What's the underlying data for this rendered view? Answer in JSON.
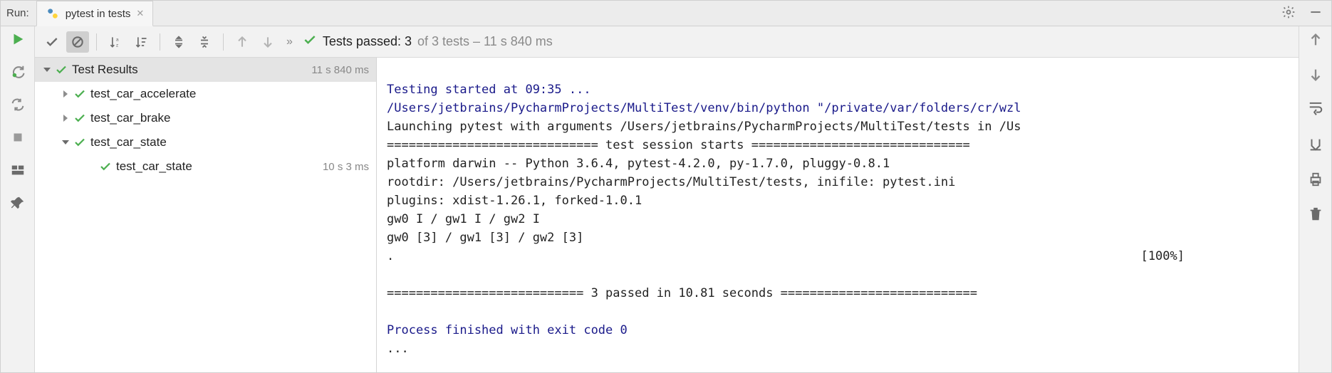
{
  "header": {
    "run_label": "Run:",
    "tab_label": "pytest in tests"
  },
  "toolbar": {
    "status_prefix": "Tests passed:",
    "passed_count": "3",
    "of_text": "of 3 tests – 11 s 840 ms"
  },
  "tree": {
    "root": {
      "label": "Test Results",
      "time": "11 s 840 ms"
    },
    "nodes": [
      {
        "label": "test_car_accelerate",
        "time": ""
      },
      {
        "label": "test_car_brake",
        "time": ""
      },
      {
        "label": "test_car_state",
        "time": "",
        "expanded": true
      },
      {
        "label": "test_car_state",
        "time": "10 s 3 ms",
        "child": true
      }
    ]
  },
  "console": {
    "l1": "Testing started at 09:35 ...",
    "l2": "/Users/jetbrains/PycharmProjects/MultiTest/venv/bin/python \"/private/var/folders/cr/wzl",
    "l3": "Launching pytest with arguments /Users/jetbrains/PycharmProjects/MultiTest/tests in /Us",
    "l4": "============================= test session starts ==============================",
    "l5": "platform darwin -- Python 3.6.4, pytest-4.2.0, py-1.7.0, pluggy-0.8.1",
    "l6": "rootdir: /Users/jetbrains/PycharmProjects/MultiTest/tests, inifile: pytest.ini",
    "l7": "plugins: xdist-1.26.1, forked-1.0.1",
    "l8": "gw0 I / gw1 I / gw2 I",
    "l9": "gw0 [3] / gw1 [3] / gw2 [3]",
    "l10_left": ".",
    "l10_right": "[100%]",
    "l11": "=========================== 3 passed in 10.81 seconds ===========================",
    "l12": "",
    "l13": "Process finished with exit code 0",
    "l14": "..."
  }
}
